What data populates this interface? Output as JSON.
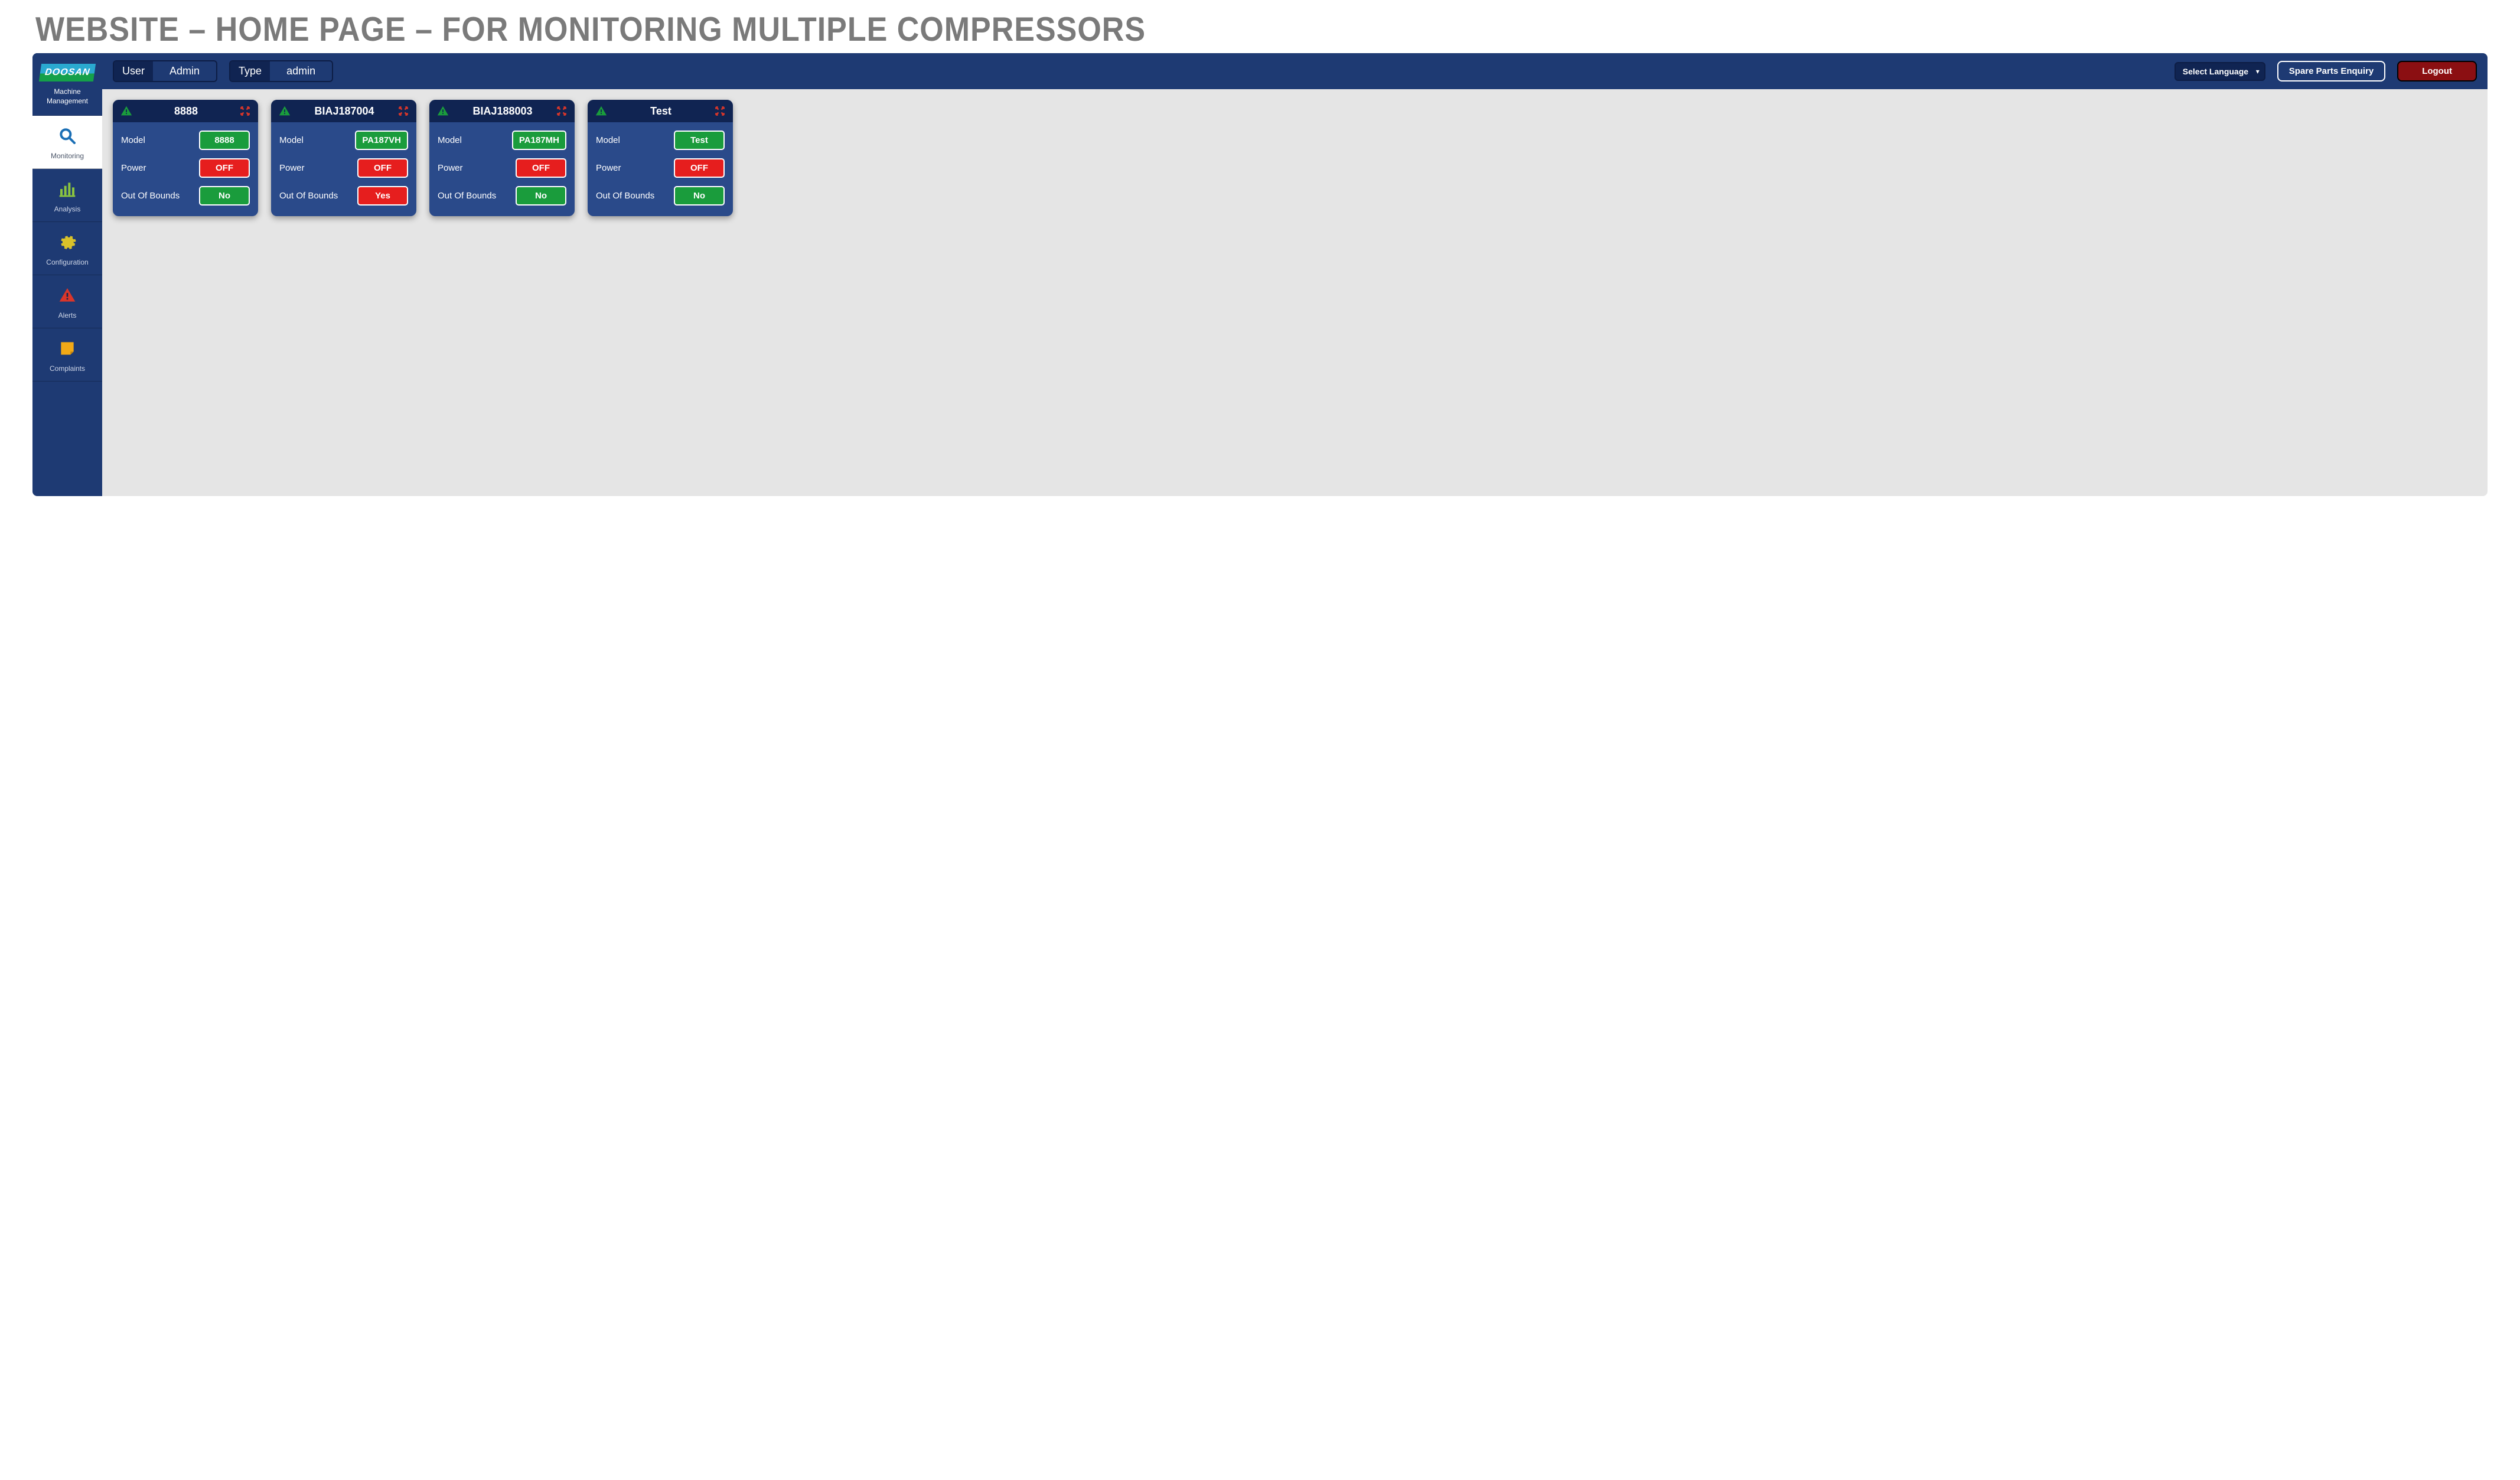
{
  "slide_title": "WEBSITE – HOME PAGE – FOR MONITORING MULTIPLE COMPRESSORS",
  "brand": {
    "logo_text": "DOOSAN",
    "caption_line1": "Machine",
    "caption_line2": "Management"
  },
  "sidebar": {
    "items": [
      {
        "id": "monitoring",
        "label": "Monitoring",
        "active": true
      },
      {
        "id": "analysis",
        "label": "Analysis",
        "active": false
      },
      {
        "id": "configuration",
        "label": "Configuration",
        "active": false
      },
      {
        "id": "alerts",
        "label": "Alerts",
        "active": false
      },
      {
        "id": "complaints",
        "label": "Complaints",
        "active": false
      }
    ]
  },
  "topbar": {
    "user_key": "User",
    "user_val": "Admin",
    "type_key": "Type",
    "type_val": "admin",
    "lang_placeholder": "Select Language",
    "spare_parts": "Spare Parts Enquiry",
    "logout": "Logout"
  },
  "labels": {
    "model": "Model",
    "power": "Power",
    "oob": "Out Of Bounds"
  },
  "cards": [
    {
      "title": "8888",
      "model": "8888",
      "model_color": "green",
      "power": "OFF",
      "power_color": "red",
      "oob": "No",
      "oob_color": "green"
    },
    {
      "title": "BIAJ187004",
      "model": "PA187VH",
      "model_color": "green",
      "power": "OFF",
      "power_color": "red",
      "oob": "Yes",
      "oob_color": "red"
    },
    {
      "title": "BIAJ188003",
      "model": "PA187MH",
      "model_color": "green",
      "power": "OFF",
      "power_color": "red",
      "oob": "No",
      "oob_color": "green"
    },
    {
      "title": "Test",
      "model": "Test",
      "model_color": "green",
      "power": "OFF",
      "power_color": "red",
      "oob": "No",
      "oob_color": "green"
    }
  ]
}
